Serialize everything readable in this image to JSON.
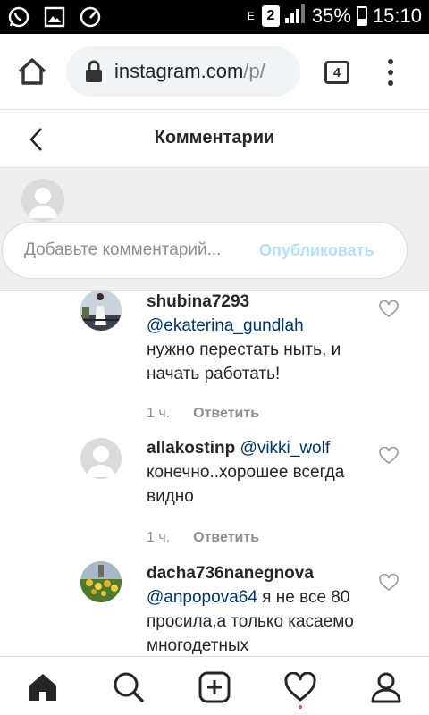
{
  "status_bar": {
    "e_indicator": "E",
    "sim": "2",
    "battery": "35%",
    "battery_level": 0.35,
    "time": "15:10",
    "left_icons": [
      "whatsapp-icon",
      "gallery-icon",
      "speedometer-icon"
    ]
  },
  "browser": {
    "url_host": "instagram.com",
    "url_path": "/p/",
    "tab_count": "4"
  },
  "header": {
    "title": "Комментарии"
  },
  "composer": {
    "placeholder": "Добавьте комментарий...",
    "value": "",
    "publish_label": "Опубликовать"
  },
  "comments": [
    {
      "username": "shubina7293",
      "mention": "@ekaterina_gundlah",
      "text": "нужно перестать ныть, и начать работать!",
      "time": "1 ч.",
      "reply_label": "Ответить",
      "avatar": "photo"
    },
    {
      "username": "allakostinp",
      "mention": "@vikki_wolf",
      "text": "конечно..хорошее всегда видно",
      "time": "1 ч.",
      "reply_label": "Ответить",
      "avatar": "default"
    },
    {
      "username": "dacha736nanegnova",
      "mention": "@anpopova64",
      "text": "я не все 80 просила,а только касаемо многодетных",
      "avatar": "photo"
    }
  ],
  "colors": {
    "link": "#003569",
    "publish_disabled": "#b2dffc",
    "muted": "#8e8e8e",
    "notification_dot": "#ed4956"
  },
  "bottom_nav": [
    "home-icon",
    "search-icon",
    "new-post-icon",
    "heart-icon",
    "profile-icon"
  ]
}
